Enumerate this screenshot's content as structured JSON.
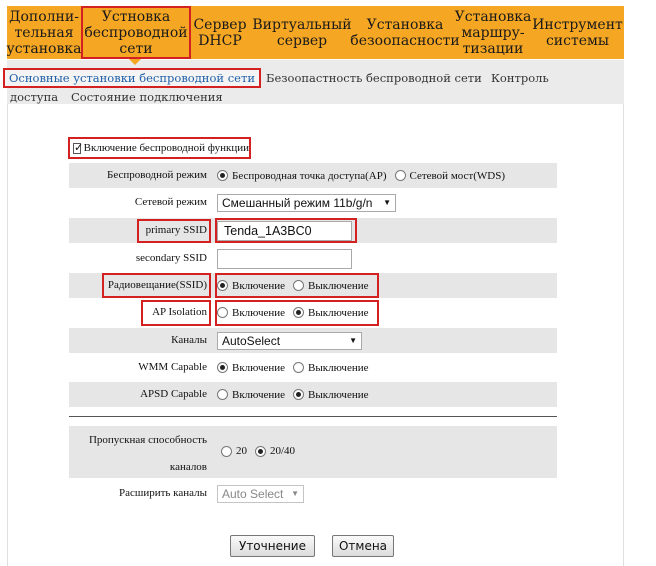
{
  "topnav": {
    "items": [
      {
        "label": "Дополни-\nтельная\nустановка"
      },
      {
        "label": "Устновка\nбеспроводной\nсети"
      },
      {
        "label": "Сервер\nDHCP"
      },
      {
        "label": "Виртуальный\nсервер"
      },
      {
        "label": "Установка\nбезоопасности"
      },
      {
        "label": "Установка\nмаршру-\nтизации"
      },
      {
        "label": "Инструмент\nсистемы"
      }
    ]
  },
  "subnav": {
    "items": [
      {
        "label": "Основные установки беспроводной сети"
      },
      {
        "label": "Безоопастность беспроводной сети"
      },
      {
        "label": "Контроль"
      },
      {
        "label": "доступа"
      },
      {
        "label": "Состояние подключения"
      }
    ]
  },
  "form": {
    "enable_label": "Включение беспроводной функции",
    "mode": {
      "label": "Беспроводной режим",
      "opt1": "Беспроводная точка доступа(AP)",
      "opt2": "Сетевой мост(WDS)"
    },
    "netmode": {
      "label": "Сетевой режим",
      "value": "Смешанный режим 11b/g/n"
    },
    "primary_ssid": {
      "label": "primary SSID",
      "value": "Tenda_1A3BC0"
    },
    "secondary_ssid": {
      "label": "secondary SSID",
      "value": ""
    },
    "broadcast": {
      "label": "Радиовещание(SSID)",
      "on": "Включение",
      "off": "Выключение"
    },
    "ap_isolation": {
      "label": "AP Isolation",
      "on": "Включение",
      "off": "Выключение"
    },
    "channel": {
      "label": "Каналы",
      "value": "AutoSelect"
    },
    "wmm": {
      "label": "WMM Capable",
      "on": "Включение",
      "off": "Выключение"
    },
    "apsd": {
      "label": "APSD Capable",
      "on": "Включение",
      "off": "Выключение"
    },
    "bandwidth": {
      "label1": "Пропускная способность",
      "label2": "каналов",
      "opt1": "20",
      "opt2": "20/40"
    },
    "ext_channel": {
      "label": "Расширить каналы",
      "value": "Auto Select"
    }
  },
  "buttons": {
    "save": "Уточнение",
    "cancel": "Отмена"
  },
  "colors": {
    "nav_bg": "#f5a623",
    "highlight": "#d32020",
    "active_link": "#1f5fa8",
    "row_shade": "#e6e6e6"
  }
}
